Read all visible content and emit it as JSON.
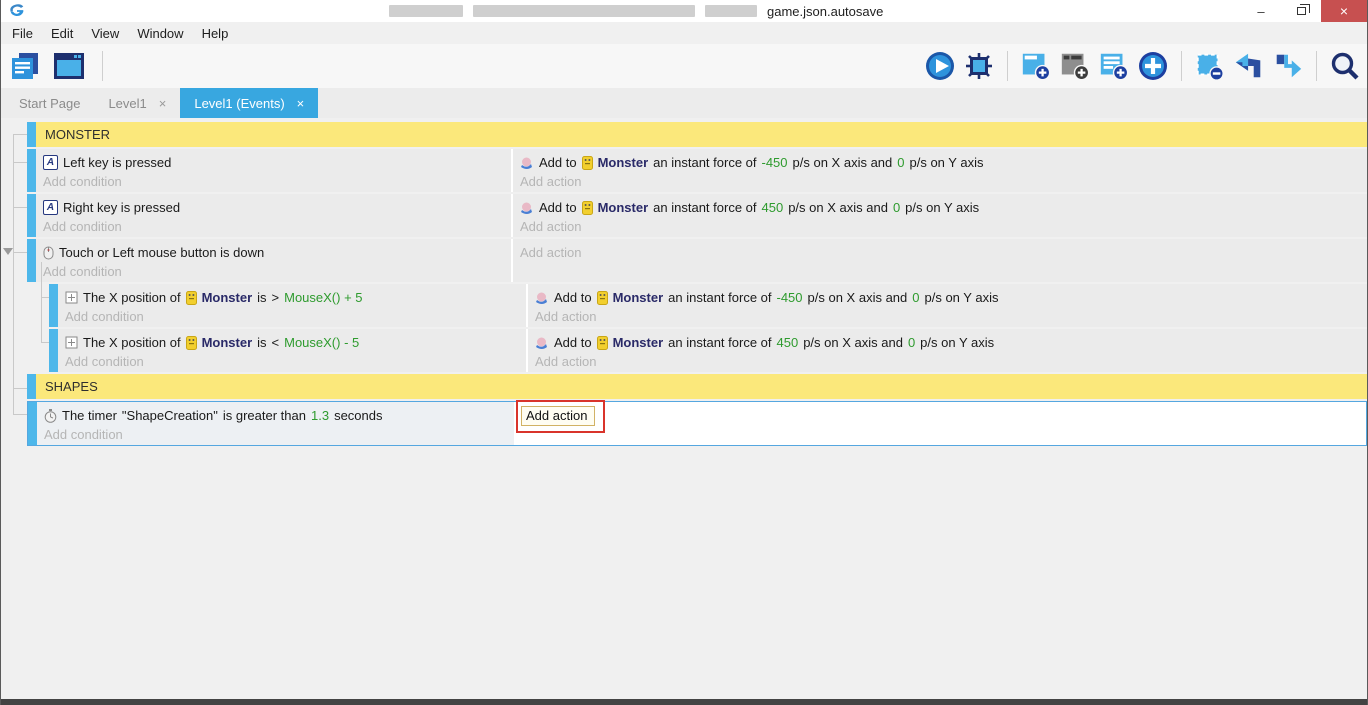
{
  "window": {
    "title": "game.json.autosave",
    "controls": {
      "minimize": "–",
      "close": "×"
    }
  },
  "menu": {
    "items": [
      "File",
      "Edit",
      "View",
      "Window",
      "Help"
    ]
  },
  "toolbar": {
    "icons": [
      "project-manager",
      "scene-editor",
      "play-preview",
      "debug",
      "add-event",
      "add-comment",
      "add-subevent",
      "add-new",
      "delete-selection",
      "undo",
      "redo",
      "search"
    ]
  },
  "tabs": [
    {
      "label": "Start Page"
    },
    {
      "label": "Level1",
      "close": "×"
    },
    {
      "label": "Level1 (Events)",
      "close": "×",
      "active": true
    }
  ],
  "icons": {
    "keyboard_letter": "A"
  },
  "colors": {
    "accent_blue": "#38a7e0",
    "comment_yellow": "#fbe87b",
    "event_strip_blue": "#4db7ea",
    "value_green": "#2e9b2e",
    "object_navy": "#2a2a68",
    "annotation_red": "#d9342b",
    "close_button_red": "#c75050"
  },
  "sheet": {
    "comment_monster": "MONSTER",
    "comment_shapes": "SHAPES",
    "add_condition": "Add condition",
    "add_action": "Add action",
    "events": [
      {
        "cond": "Left key is pressed",
        "act": {
          "pre": "Add to",
          "obj": "Monster",
          "m1": "an instant force of",
          "vx": "-450",
          "m2": "p/s on X axis and",
          "vy": "0",
          "m3": "p/s on Y axis"
        }
      },
      {
        "cond": "Right key is pressed",
        "act": {
          "pre": "Add to",
          "obj": "Monster",
          "m1": "an instant force of",
          "vx": "450",
          "m2": "p/s on X axis and",
          "vy": "0",
          "m3": "p/s on Y axis"
        }
      },
      {
        "cond": "Touch or Left mouse button is down"
      },
      {
        "cond_pre": "The X position of",
        "obj": "Monster",
        "cond_mid": "is",
        "op": ">",
        "expr": "MouseX() + 5",
        "act": {
          "pre": "Add to",
          "obj": "Monster",
          "m1": "an instant force of",
          "vx": "-450",
          "m2": "p/s on X axis and",
          "vy": "0",
          "m3": "p/s on Y axis"
        }
      },
      {
        "cond_pre": "The X position of",
        "obj": "Monster",
        "cond_mid": "is",
        "op": "<",
        "expr": "MouseX() - 5",
        "act": {
          "pre": "Add to",
          "obj": "Monster",
          "m1": "an instant force of",
          "vx": "450",
          "m2": "p/s on X axis and",
          "vy": "0",
          "m3": "p/s on Y axis"
        }
      },
      {
        "cond_pre": "The timer",
        "timer_name": "\"ShapeCreation\"",
        "cond_mid": "is greater than",
        "value": "1.3",
        "suffix": "seconds"
      }
    ]
  }
}
